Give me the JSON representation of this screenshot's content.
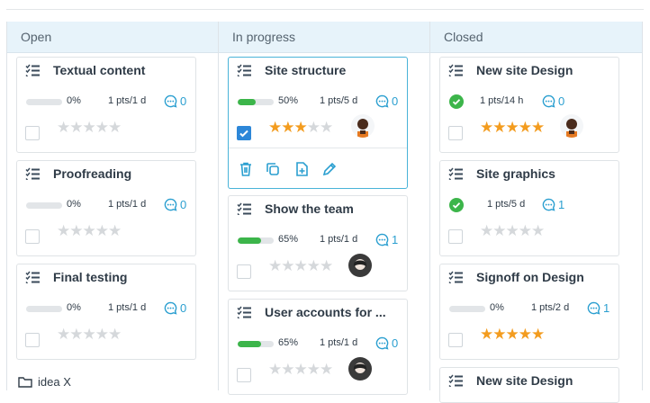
{
  "columns": [
    {
      "title": "Open"
    },
    {
      "title": "In progress"
    },
    {
      "title": "Closed"
    }
  ],
  "open_cards": [
    {
      "title": "Textual content",
      "percent": "0%",
      "progress": 0,
      "pts": "1 pts/1 d",
      "comments": "0",
      "stars": 0
    },
    {
      "title": "Proofreading",
      "percent": "0%",
      "progress": 0,
      "pts": "1 pts/1 d",
      "comments": "0",
      "stars": 0
    },
    {
      "title": "Final testing",
      "percent": "0%",
      "progress": 0,
      "pts": "1 pts/1 d",
      "comments": "0",
      "stars": 0
    }
  ],
  "folder": {
    "label": "idea X"
  },
  "progress_cards": [
    {
      "title": "Site structure",
      "percent": "50%",
      "progress": 0.5,
      "pts": "1 pts/5 d",
      "comments": "0",
      "stars": 3,
      "checked": true
    },
    {
      "title": "Show the team",
      "percent": "65%",
      "progress": 0.65,
      "pts": "1 pts/1 d",
      "comments": "1",
      "stars": 0
    },
    {
      "title": "User accounts for ...",
      "percent": "65%",
      "progress": 0.65,
      "pts": "1 pts/1 d",
      "comments": "0",
      "stars": 0
    }
  ],
  "closed_cards": [
    {
      "title": "New site Design",
      "pts": "1 pts/14 h",
      "comments": "0",
      "stars": 5,
      "done": true
    },
    {
      "title": "Site graphics",
      "pts": "1 pts/5 d",
      "comments": "1",
      "stars": 0,
      "done": true
    },
    {
      "title": "Signoff on Design",
      "percent": "0%",
      "progress": 0,
      "pts": "1 pts/2 d",
      "comments": "1",
      "stars": 5
    },
    {
      "title": "New site Design"
    }
  ],
  "colors": {
    "accent": "#2b9fd0",
    "progress": "#3cb54a",
    "star": "#f39c1f",
    "done": "#3cb54a",
    "header_bg": "#e7f3fa"
  },
  "icons": [
    "task-list-icon",
    "comment-icon",
    "star-icon",
    "check-circle-icon",
    "trash-icon",
    "copy-icon",
    "add-subtask-icon",
    "edit-icon",
    "folder-icon"
  ]
}
